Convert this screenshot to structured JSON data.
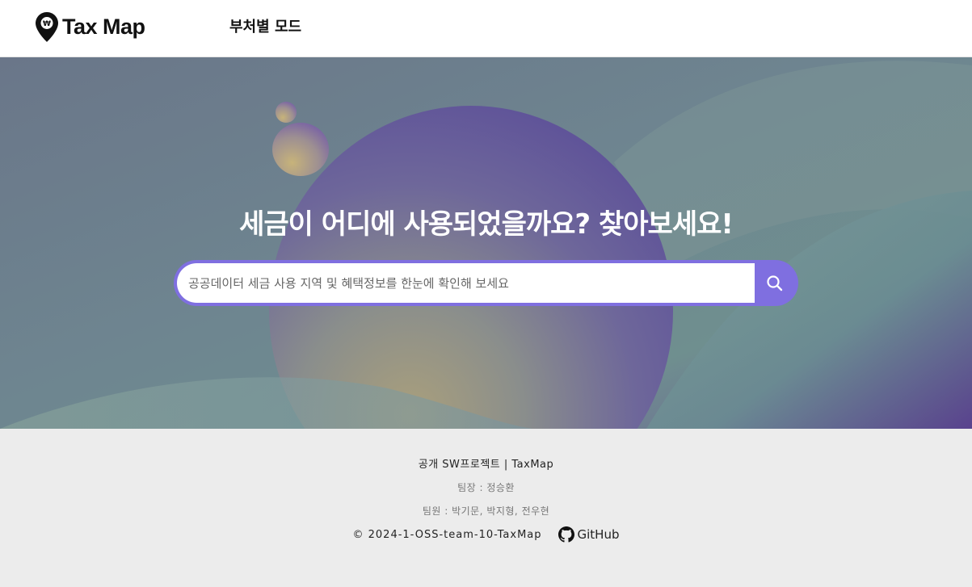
{
  "header": {
    "logo_text": "Tax Map",
    "logo_icon": "won-map-pin-icon",
    "nav_link": "부처별 모드"
  },
  "hero": {
    "title": "세금이 어디에 사용되었을까요? 찾아보세요!",
    "search": {
      "placeholder": "공공데이터 세금 사용 지역 및 혜택정보를 한눈에 확인해 보세요",
      "value": "",
      "button_icon": "search-icon"
    }
  },
  "footer": {
    "project": "공개 SW프로젝트 | TaxMap",
    "leader": "팀장 : 정승환",
    "members": "팀원 : 박기문, 박지형, 전우현",
    "copyright": "© 2024-1-OSS-team-10-TaxMap",
    "github_label": "GitHub",
    "github_icon": "github-icon"
  },
  "colors": {
    "accent": "#7f6fe0",
    "header_bg": "#ffffff",
    "footer_bg": "#ececec",
    "hero_text": "#ffffff"
  }
}
